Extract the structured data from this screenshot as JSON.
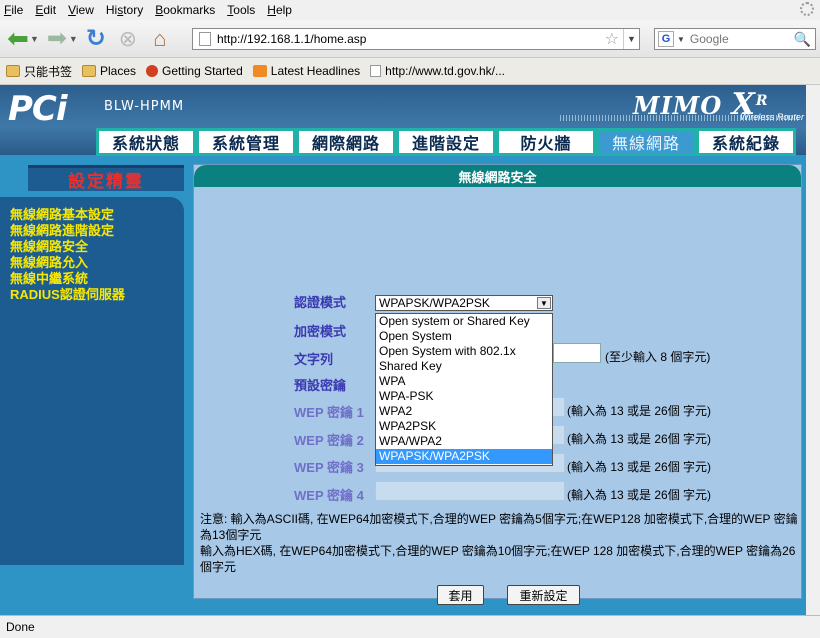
{
  "browser": {
    "menu": [
      {
        "pre": "",
        "u": "F",
        "post": "ile"
      },
      {
        "pre": "",
        "u": "E",
        "post": "dit"
      },
      {
        "pre": "",
        "u": "V",
        "post": "iew"
      },
      {
        "pre": "Hi",
        "u": "s",
        "post": "tory"
      },
      {
        "pre": "",
        "u": "B",
        "post": "ookmarks"
      },
      {
        "pre": "",
        "u": "T",
        "post": "ools"
      },
      {
        "pre": "",
        "u": "H",
        "post": "elp"
      }
    ],
    "url": "http://192.168.1.1/home.asp",
    "search_placeholder": "Google",
    "bookmarks": [
      "只能书签",
      "Places",
      "Getting Started",
      "Latest Headlines",
      "http://www.td.gov.hk/..."
    ],
    "status": "Done"
  },
  "router": {
    "brand": "PCi",
    "model": "BLW-HPMM",
    "mimo": "MIMO",
    "mimo_x": "X",
    "mimo_r": "R",
    "mimo_sub": "Wireless Router",
    "tabs": [
      "系統狀態",
      "系統管理",
      "網際網路",
      "進階設定",
      "防火牆",
      "無線網路",
      "系統紀錄"
    ],
    "active_tab": 5,
    "sidebar_title": "設定精靈",
    "sidebar_links": [
      "無線網路基本設定",
      "無線網路進階設定",
      "無線網路安全",
      "無線網路允入",
      "無線中繼系統",
      "RADIUS認證伺服器"
    ],
    "panel_title": "無線網路安全",
    "labels": {
      "auth": "認證模式",
      "encrypt": "加密模式",
      "text": "文字列",
      "default_key": "預設密鑰",
      "wep1": "WEP 密鑰 1",
      "wep2": "WEP 密鑰 2",
      "wep3": "WEP 密鑰 3",
      "wep4": "WEP 密鑰 4"
    },
    "auth_value": "WPAPSK/WPA2PSK",
    "auth_options": [
      "Open system or Shared Key",
      "Open System",
      "Open System with 802.1x",
      "Shared Key",
      "WPA",
      "WPA-PSK",
      "WPA2",
      "WPA2PSK",
      "WPA/WPA2",
      "WPAPSK/WPA2PSK"
    ],
    "auth_selected_index": 9,
    "text_hint": "(至少輸入 8 個字元)",
    "wep_hint": "(輸入為 13 或是 26個 字元)",
    "notes": [
      "注意: 輸入為ASCII碼, 在WEP64加密模式下,合理的WEP 密鑰為5個字元;在WEP128 加密模式下,合理的WEP 密鑰為13個字元",
      "輸入為HEX碼, 在WEP64加密模式下,合理的WEP 密鑰為10個字元;在WEP 128 加密模式下,合理的WEP 密鑰為26個字元"
    ],
    "apply_label": "套用",
    "reset_label": "重新設定"
  }
}
